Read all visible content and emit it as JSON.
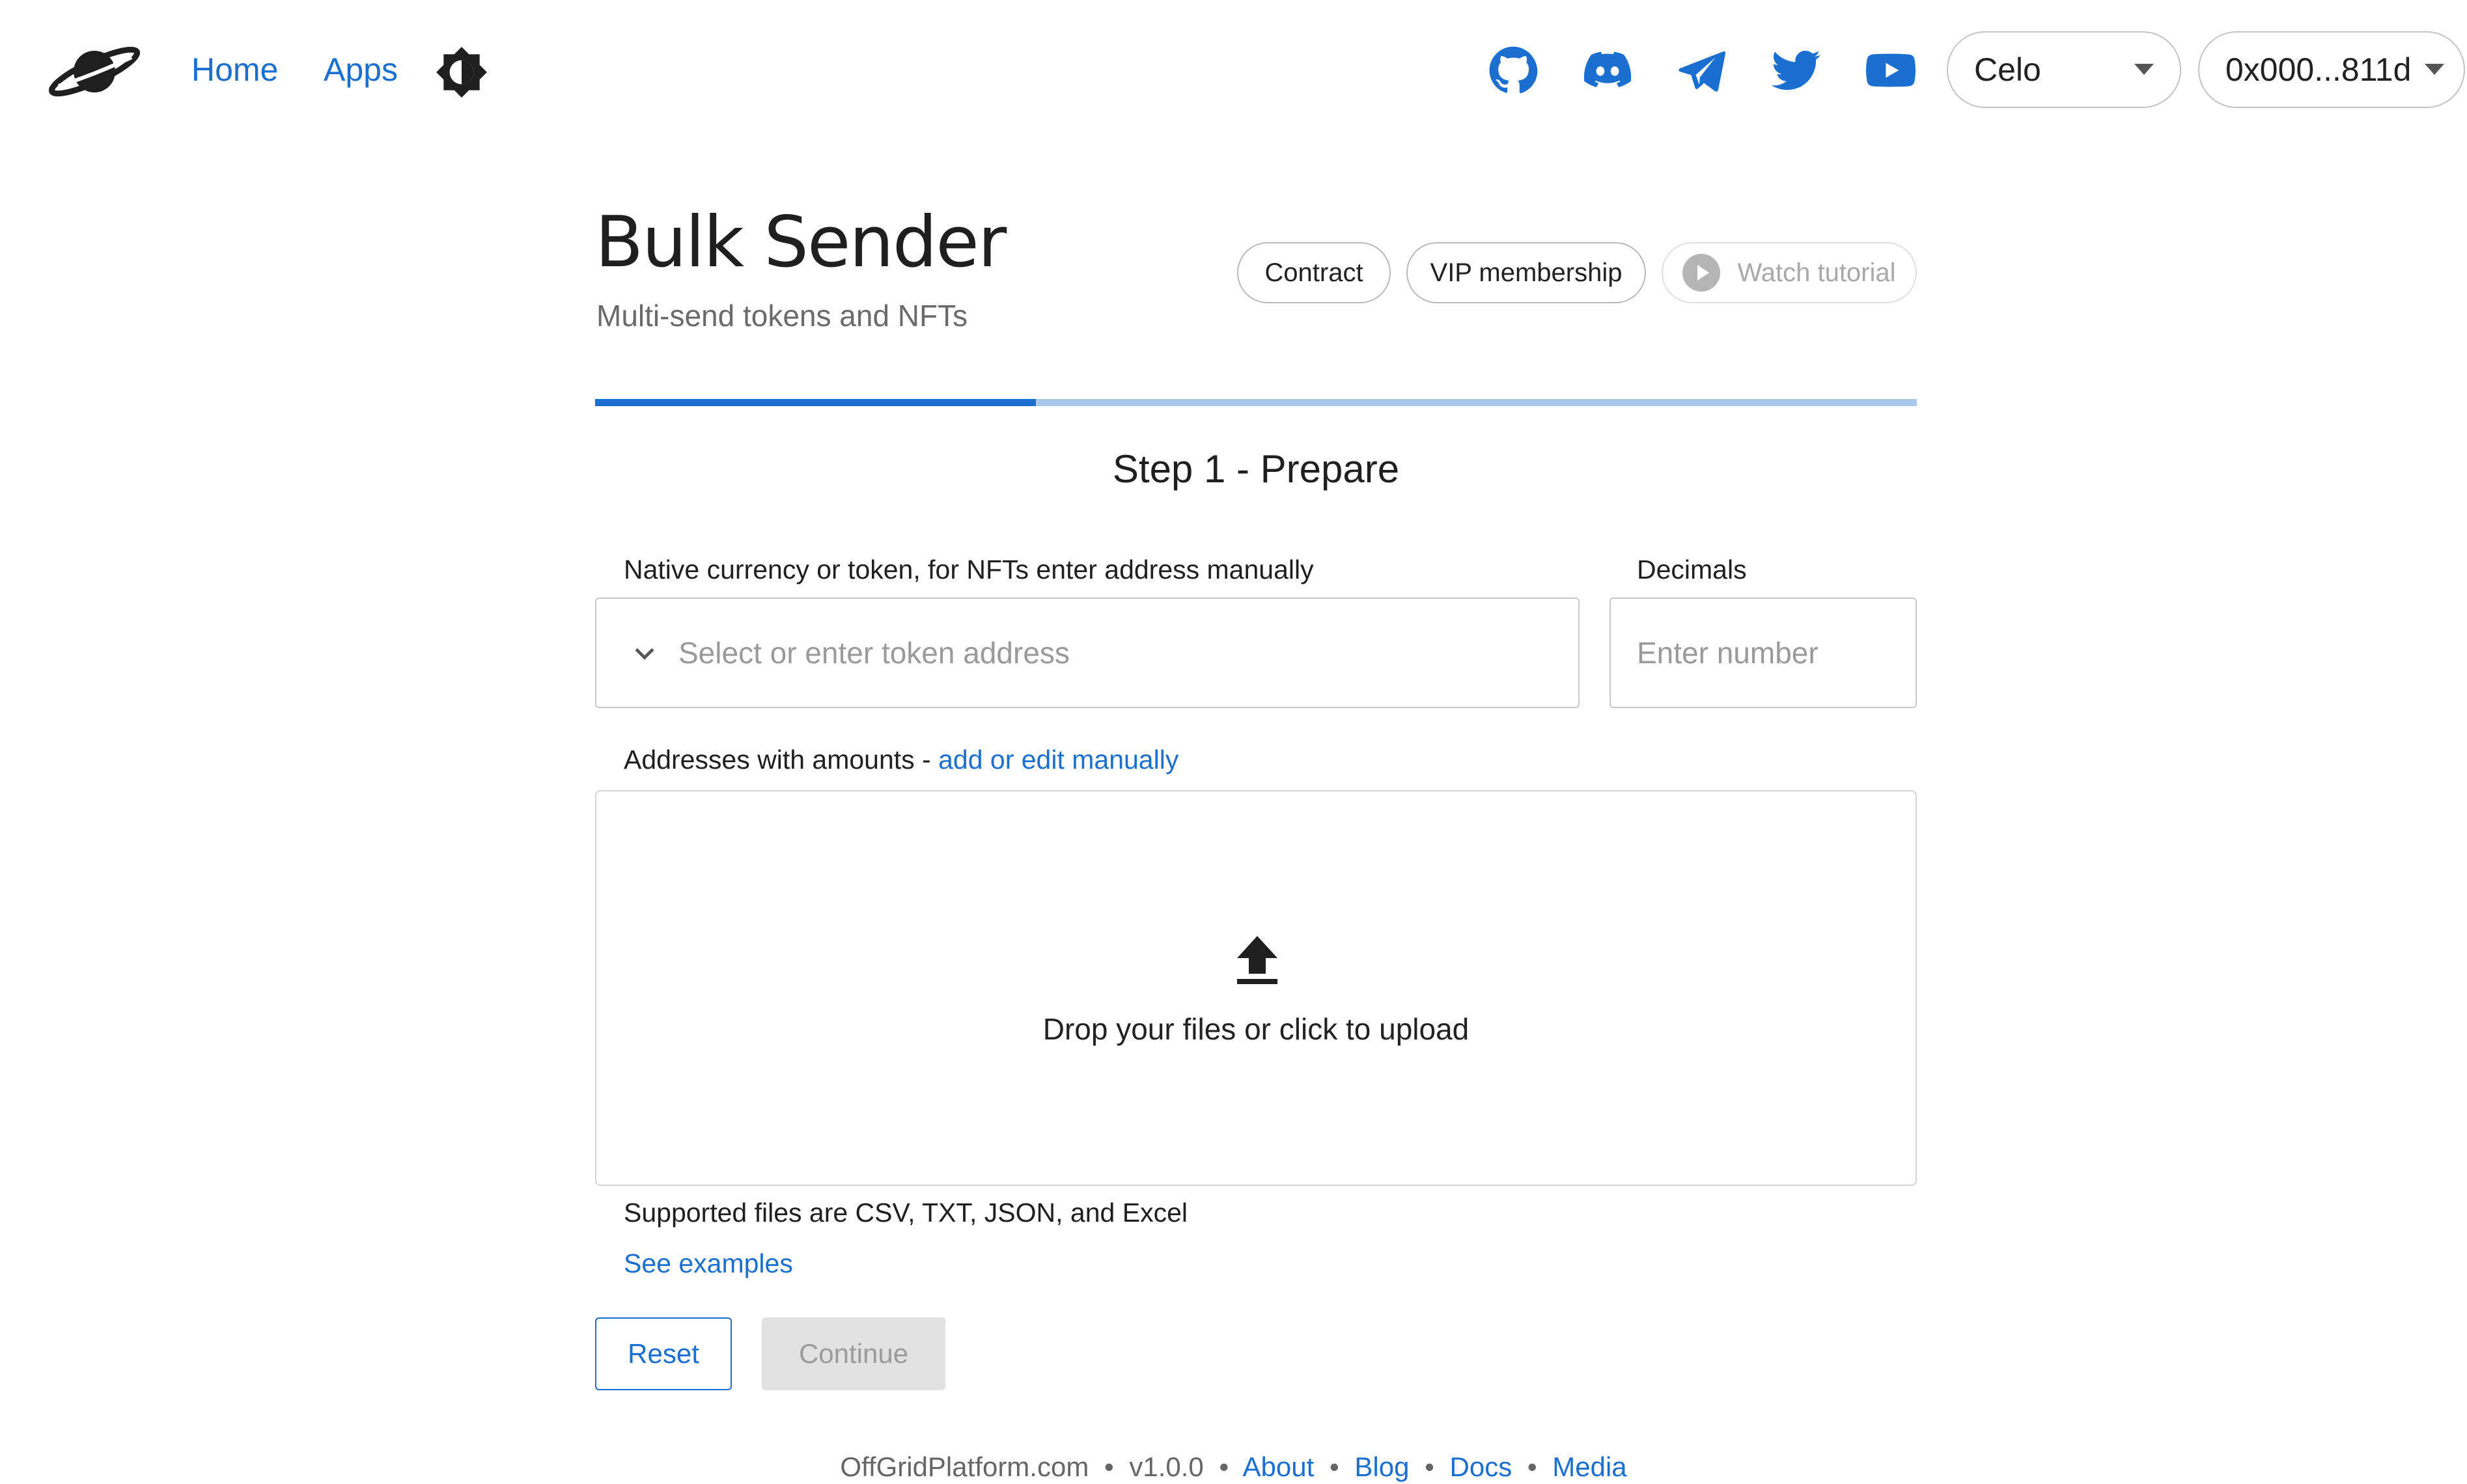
{
  "header": {
    "nav": [
      {
        "label": "Home"
      },
      {
        "label": "Apps"
      }
    ],
    "network_select": {
      "value": "Celo"
    },
    "wallet_select": {
      "value": "0x000...811d"
    },
    "icons": [
      "saturn-logo-icon",
      "theme-toggle-icon",
      "github-icon",
      "discord-icon",
      "telegram-icon",
      "twitter-icon",
      "youtube-icon"
    ]
  },
  "page": {
    "title": "Bulk Sender",
    "subtitle": "Multi-send tokens and NFTs",
    "actions": {
      "contract": "Contract",
      "vip": "VIP membership",
      "tutorial": "Watch tutorial"
    }
  },
  "progress": {
    "value": 0.3333,
    "color_done": "#1a6fd0",
    "color_todo": "#a9c8ea"
  },
  "step": {
    "title": "Step 1 - Prepare",
    "token_label": "Native currency or token, for NFTs enter address manually",
    "token_placeholder": "Select or enter token address",
    "decimals_label": "Decimals",
    "decimals_placeholder": "Enter number",
    "addresses_label": "Addresses with amounts -",
    "addresses_link": "add or edit manually",
    "dropzone_text": "Drop your files or click to upload",
    "supported": "Supported files are CSV, TXT, JSON, and Excel",
    "examples_link": "See examples",
    "reset": "Reset",
    "continue": "Continue"
  },
  "footer": {
    "site": "OffGridPlatform.com",
    "version": "v1.0.0",
    "separator": "•",
    "links": [
      "About",
      "Blog",
      "Docs",
      "Media"
    ]
  },
  "colors": {
    "accent": "#1a6fd0",
    "disabled": "#e2e2e2"
  }
}
